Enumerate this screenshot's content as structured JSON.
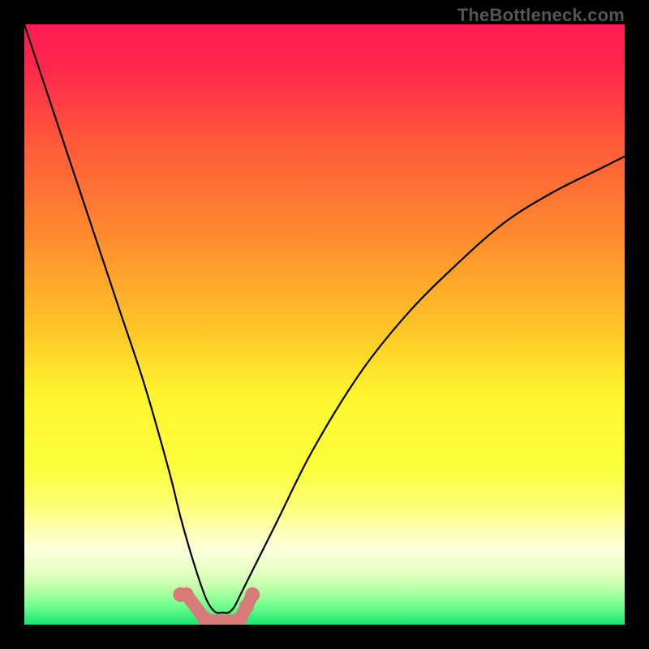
{
  "watermark": {
    "text": "TheBottleneck.com"
  },
  "chart_data": {
    "type": "line",
    "title": "",
    "xlabel": "",
    "ylabel": "",
    "ylim": [
      0,
      100
    ],
    "series": [
      {
        "name": "bottleneck-curve",
        "x": [
          0,
          4,
          8,
          12,
          16,
          20,
          24,
          26,
          28,
          30,
          31,
          32,
          33,
          34,
          35,
          36,
          38,
          42,
          48,
          56,
          64,
          72,
          80,
          88,
          96,
          100
        ],
        "values": [
          100,
          88,
          76,
          64,
          52,
          40,
          26,
          18,
          11,
          5,
          3,
          2,
          2,
          2,
          3,
          5,
          9,
          17,
          29,
          42,
          52,
          60,
          67,
          72,
          76,
          78
        ]
      },
      {
        "name": "green-range-points",
        "x": [
          26,
          27,
          30,
          31,
          32,
          33,
          34,
          35,
          36,
          37,
          38
        ],
        "values": [
          5,
          5,
          1,
          0.5,
          0.5,
          0.5,
          0.5,
          0.5,
          1,
          3,
          5
        ]
      }
    ],
    "gradient_stops": [
      {
        "pos": 0.0,
        "color": "#ff1b52"
      },
      {
        "pos": 0.08,
        "color": "#ff2a4b"
      },
      {
        "pos": 0.2,
        "color": "#ff5a3a"
      },
      {
        "pos": 0.35,
        "color": "#ff8a2f"
      },
      {
        "pos": 0.5,
        "color": "#ffc228"
      },
      {
        "pos": 0.62,
        "color": "#fff62e"
      },
      {
        "pos": 0.74,
        "color": "#fbff3c"
      },
      {
        "pos": 0.8,
        "color": "#fcff70"
      },
      {
        "pos": 0.845,
        "color": "#ffffb8"
      },
      {
        "pos": 0.875,
        "color": "#fbffdc"
      },
      {
        "pos": 0.905,
        "color": "#ecffc8"
      },
      {
        "pos": 0.935,
        "color": "#c6ffae"
      },
      {
        "pos": 0.965,
        "color": "#7cff90"
      },
      {
        "pos": 1.0,
        "color": "#19e86f"
      }
    ],
    "marker_color": "#d87a78",
    "curve_color": "#000000"
  }
}
